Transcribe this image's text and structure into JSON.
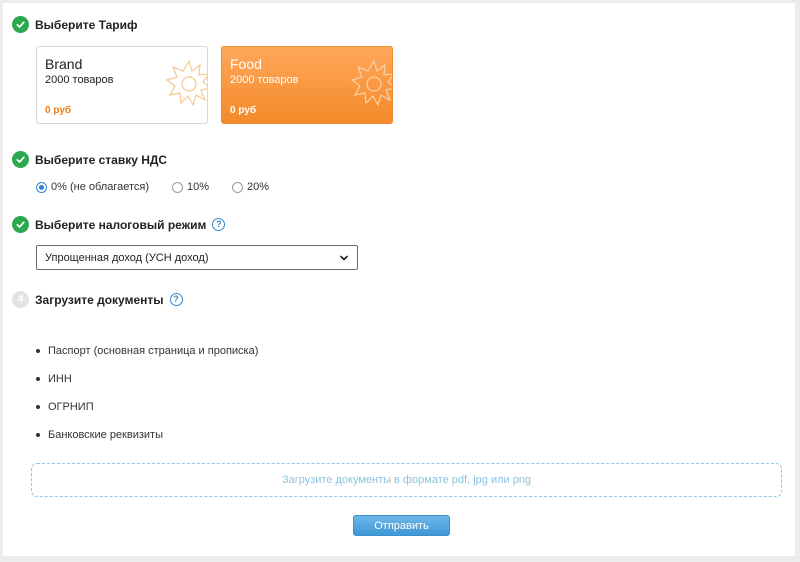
{
  "steps": {
    "tariff": {
      "title": "Выберите Тариф"
    },
    "vat": {
      "title": "Выберите ставку НДС"
    },
    "tax": {
      "title": "Выберите налоговый режим"
    },
    "docs": {
      "title": "Загрузите документы",
      "number": "4"
    }
  },
  "help_icon": "?",
  "tariffs": [
    {
      "name": "Brand",
      "count": "2000 товаров",
      "price": "0 руб",
      "selected": false
    },
    {
      "name": "Food",
      "count": "2000 товаров",
      "price": "0 руб",
      "selected": true
    }
  ],
  "vat_options": [
    {
      "label": "0% (не облагается)",
      "checked": true
    },
    {
      "label": "10%",
      "checked": false
    },
    {
      "label": "20%",
      "checked": false
    }
  ],
  "tax_select": {
    "value": "Упрощенная доход (УСН доход)"
  },
  "documents": [
    "Паспорт (основная страница и прописка)",
    "ИНН",
    "ОГРНИП",
    "Банковские реквизиты"
  ],
  "upload": {
    "label": "Загрузите документы в формате pdf, jpg или png"
  },
  "submit": {
    "label": "Отправить"
  },
  "colors": {
    "success": "#2ea84f",
    "accent": "#f48a2b",
    "primary": "#3f97d6",
    "upload_border": "#8ec8e6"
  },
  "icons": {
    "step_done": "check-icon",
    "help": "question-icon",
    "tariff_badge": "sun-icon",
    "select": "chevron-down-icon"
  }
}
